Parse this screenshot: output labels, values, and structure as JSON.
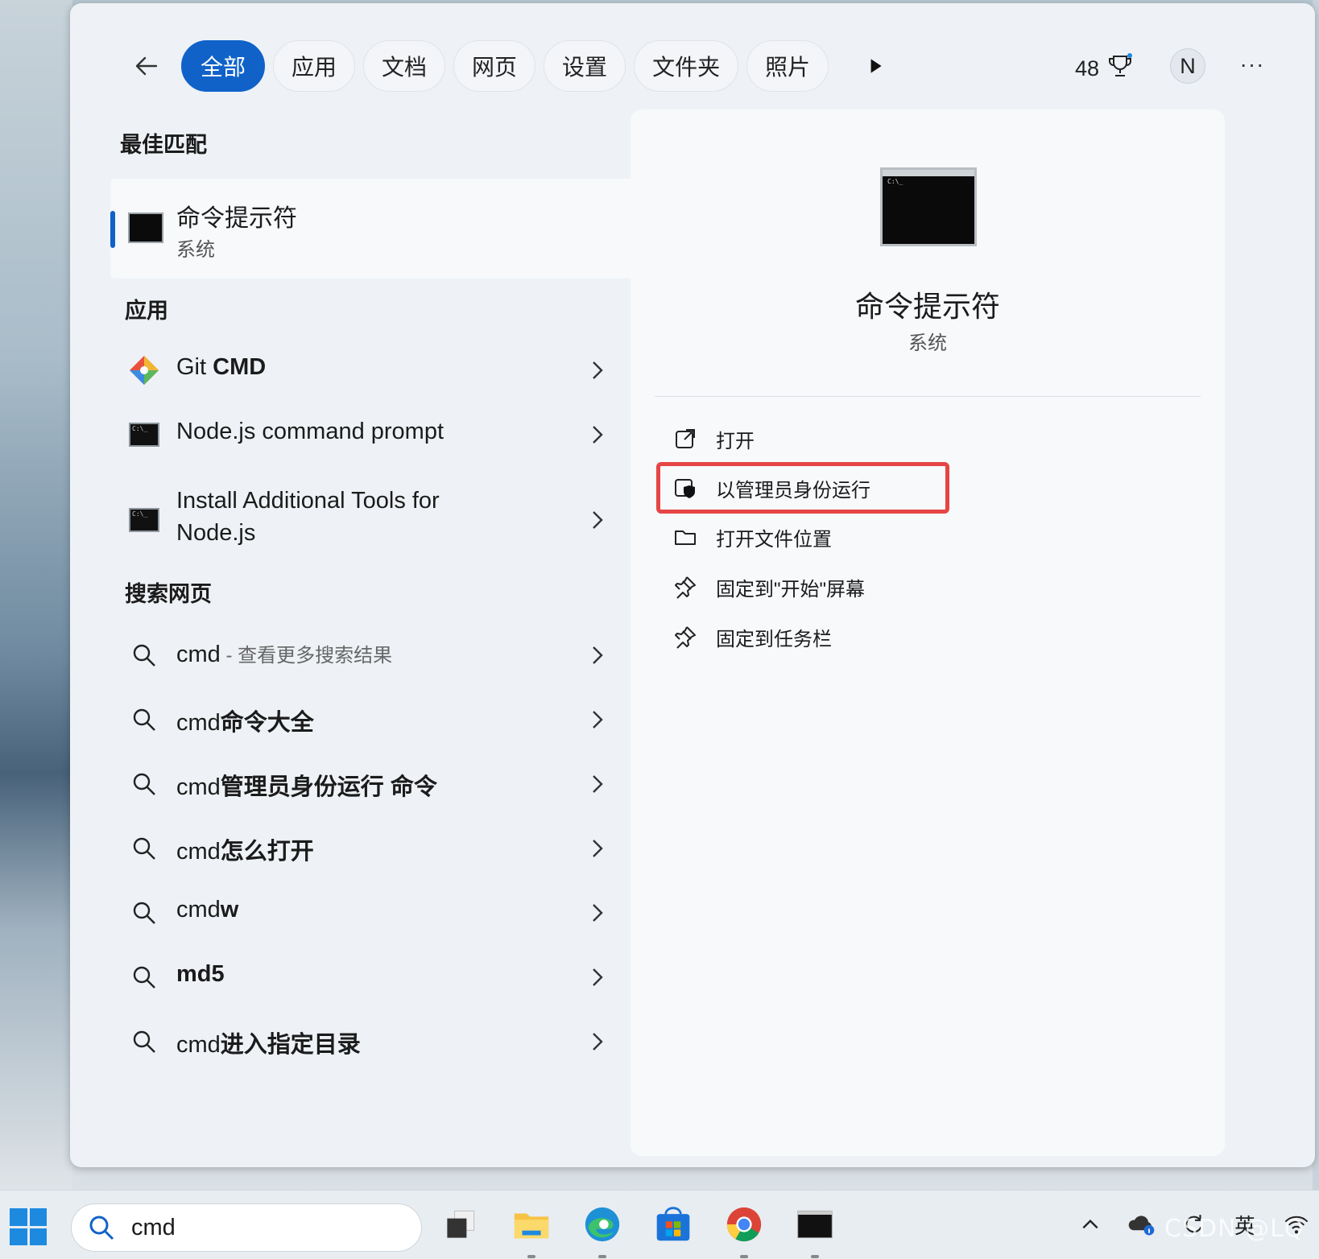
{
  "filters": {
    "tabs": [
      "全部",
      "应用",
      "文档",
      "网页",
      "设置",
      "文件夹",
      "照片"
    ],
    "active_index": 0
  },
  "account": {
    "points": "48",
    "avatar_letter": "N"
  },
  "best_match": {
    "heading": "最佳匹配",
    "title": "命令提示符",
    "subtitle": "系统"
  },
  "apps": {
    "heading": "应用",
    "items": [
      {
        "plain": "Git ",
        "bold": "CMD",
        "icon": "git-icon"
      },
      {
        "plain": "Node.js command prompt",
        "bold": "",
        "icon": "console-icon"
      },
      {
        "plain": "Install Additional Tools for Node.js",
        "bold": "",
        "icon": "console-icon"
      }
    ]
  },
  "web": {
    "heading": "搜索网页",
    "items": [
      {
        "plain": "cmd",
        "bold": "",
        "suffix": " - 查看更多搜索结果"
      },
      {
        "plain": "cmd",
        "bold": "命令大全",
        "suffix": ""
      },
      {
        "plain": "cmd",
        "bold": "管理员身份运行 命令",
        "suffix": ""
      },
      {
        "plain": "cmd",
        "bold": "怎么打开",
        "suffix": ""
      },
      {
        "plain": "cmd",
        "bold": "w",
        "suffix": ""
      },
      {
        "plain": "",
        "bold": "md5",
        "suffix": ""
      },
      {
        "plain": "cmd",
        "bold": "进入指定目录",
        "suffix": ""
      }
    ]
  },
  "detail": {
    "title": "命令提示符",
    "subtitle": "系统",
    "console_prompt": "C:\\_",
    "actions": [
      {
        "label": "打开",
        "icon": "open-external-icon"
      },
      {
        "label": "以管理员身份运行",
        "icon": "shield-admin-icon",
        "highlighted": true
      },
      {
        "label": "打开文件位置",
        "icon": "folder-icon"
      },
      {
        "label": "固定到\"开始\"屏幕",
        "icon": "pin-icon"
      },
      {
        "label": "固定到任务栏",
        "icon": "pin-icon"
      }
    ]
  },
  "taskbar": {
    "search_query": "cmd",
    "apps": [
      "task-view",
      "file-explorer",
      "edge",
      "microsoft-store",
      "chrome",
      "terminal"
    ],
    "ime_label": "英",
    "watermark": "CSDN @LQ"
  },
  "colors": {
    "accent": "#1062c9",
    "highlight_border": "#e64545"
  }
}
